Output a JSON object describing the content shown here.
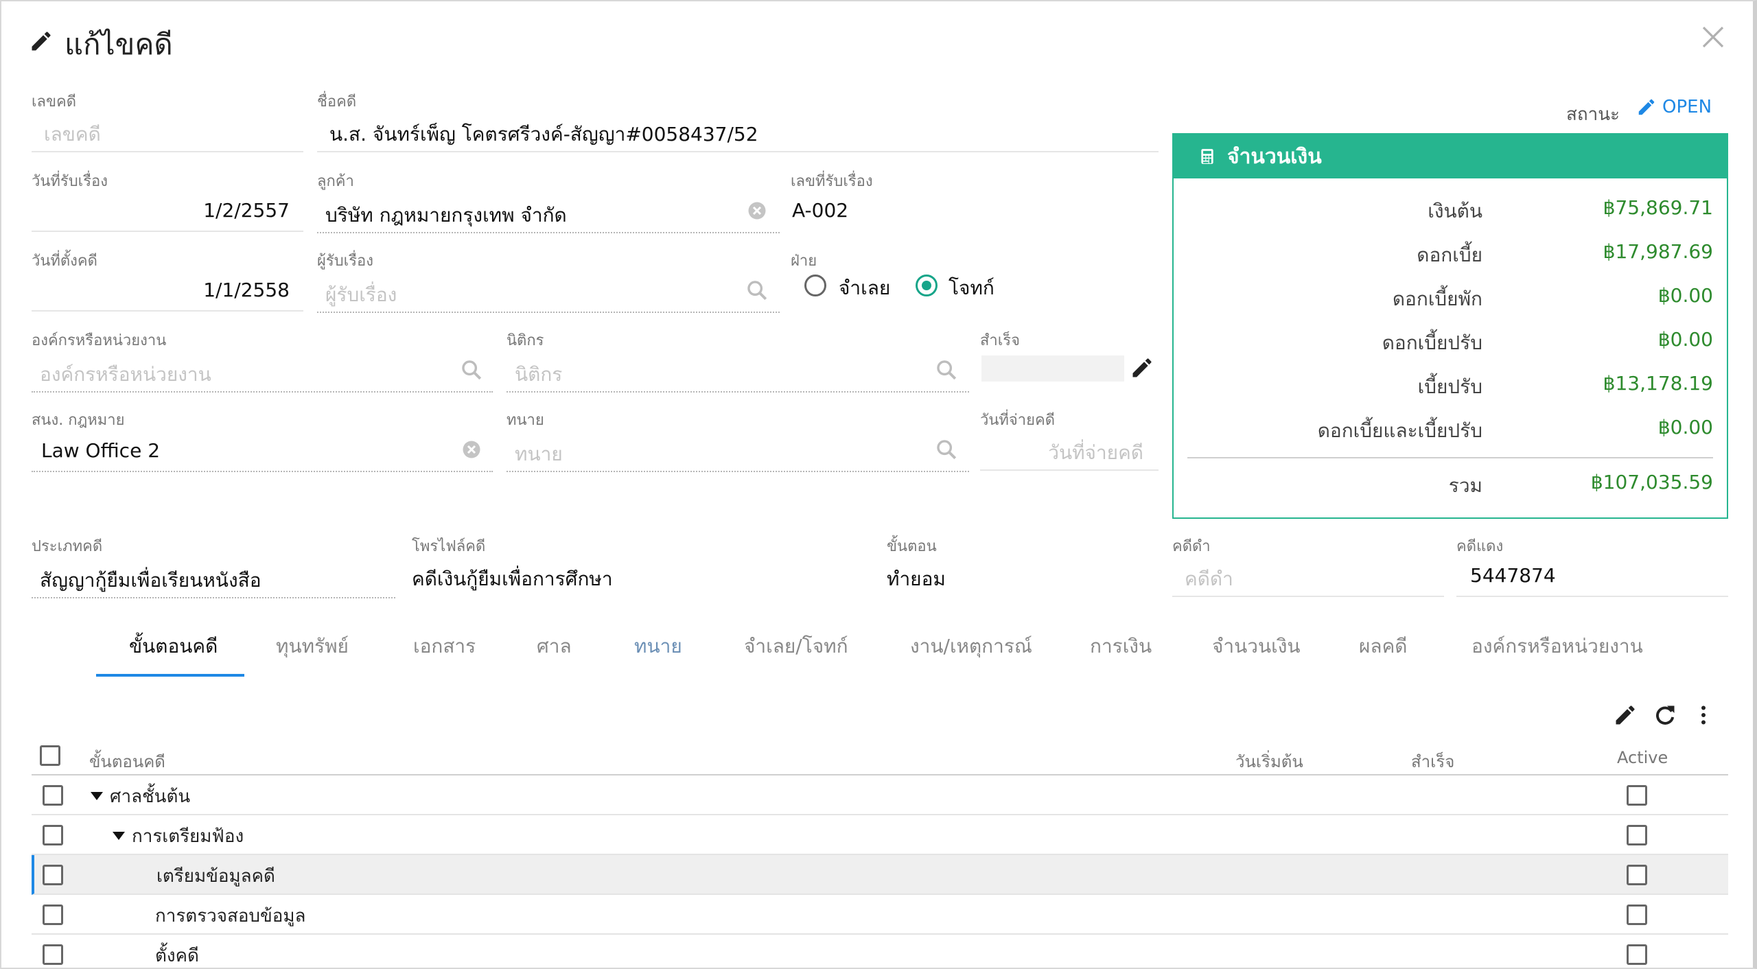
{
  "dialog": {
    "title": "แก้ไขคดี"
  },
  "fields": {
    "case_no": {
      "label": "เลขคดี",
      "placeholder": "เลขคดี"
    },
    "case_name": {
      "label": "ชื่อคดี",
      "value": "น.ส. จันทร์เพ็ญ โคตรศรีวงค์-สัญญา#0058437/52"
    },
    "received_date": {
      "label": "วันที่รับเรื่อง",
      "value": "1/2/2557"
    },
    "client": {
      "label": "ลูกค้า",
      "value": "บริษัท กฎหมายกรุงเทพ จำกัด"
    },
    "receipt_no": {
      "label": "เลขที่รับเรื่อง",
      "value": "A-002"
    },
    "filed_date": {
      "label": "วันที่ตั้งคดี",
      "value": "1/1/2558"
    },
    "assignee": {
      "label": "ผู้รับเรื่อง",
      "placeholder": "ผู้รับเรื่อง"
    },
    "party": {
      "label": "ฝ่าย",
      "options": [
        "จำเลย",
        "โจทก์"
      ],
      "selected": "โจทก์"
    },
    "organization": {
      "label": "องค์กรหรือหน่วยงาน",
      "placeholder": "องค์กรหรือหน่วยงาน"
    },
    "legal_officer": {
      "label": "นิติกร",
      "placeholder": "นิติกร"
    },
    "completed": {
      "label": "สำเร็จ"
    },
    "law_office": {
      "label": "สนง. กฎหมาย",
      "value": "Law Office 2"
    },
    "lawyer": {
      "label": "ทนาย",
      "placeholder": "ทนาย"
    },
    "disburse_date": {
      "label": "วันที่จ่ายคดี",
      "placeholder": "วันที่จ่ายคดี"
    },
    "case_type": {
      "label": "ประเภทคดี",
      "value": "สัญญากู้ยืมเพื่อเรียนหนังสือ"
    },
    "case_profile": {
      "label": "โพรไฟล์คดี",
      "value": "คดีเงินกู้ยืมเพื่อการศึกษา"
    },
    "stage": {
      "label": "ขั้นตอน",
      "value": "ทำยอม"
    },
    "black_case": {
      "label": "คดีดำ",
      "placeholder": "คดีดำ"
    },
    "red_case": {
      "label": "คดีแดง",
      "value": "5447874"
    }
  },
  "status": {
    "label": "สถานะ",
    "value": "OPEN"
  },
  "money": {
    "title": "จำนวนเงิน",
    "rows": [
      {
        "label": "เงินต้น",
        "value": "฿75,869.71"
      },
      {
        "label": "ดอกเบี้ย",
        "value": "฿17,987.69"
      },
      {
        "label": "ดอกเบี้ยพัก",
        "value": "฿0.00"
      },
      {
        "label": "ดอกเบี้ยปรับ",
        "value": "฿0.00"
      },
      {
        "label": "เบี้ยปรับ",
        "value": "฿13,178.19"
      },
      {
        "label": "ดอกเบี้ยและเบี้ยปรับ",
        "value": "฿0.00"
      }
    ],
    "total": {
      "label": "รวม",
      "value": "฿107,035.59"
    }
  },
  "tabs": [
    {
      "label": "ขั้นตอนคดี"
    },
    {
      "label": "ทุนทรัพย์"
    },
    {
      "label": "เอกสาร"
    },
    {
      "label": "ศาล"
    },
    {
      "label": "ทนาย"
    },
    {
      "label": "จำเลย/โจทก์"
    },
    {
      "label": "งาน/เหตุการณ์"
    },
    {
      "label": "การเงิน"
    },
    {
      "label": "จำนวนเงิน"
    },
    {
      "label": "ผลคดี"
    },
    {
      "label": "องค์กรหรือหน่วยงาน"
    }
  ],
  "table": {
    "columns": {
      "name": "ขั้นตอนคดี",
      "start": "วันเริ่มต้น",
      "done": "สำเร็จ",
      "active": "Active"
    },
    "rows": [
      {
        "name": "ศาลชั้นต้น"
      },
      {
        "name": "การเตรียมฟ้อง"
      },
      {
        "name": "เตรียมข้อมูลคดี"
      },
      {
        "name": "การตรวจสอบข้อมูล"
      },
      {
        "name": "ตั้งคดี"
      }
    ]
  },
  "colors": {
    "accent": "#1e88e5",
    "money_green": "#26b58f",
    "amount_green": "#2e8b2e"
  }
}
